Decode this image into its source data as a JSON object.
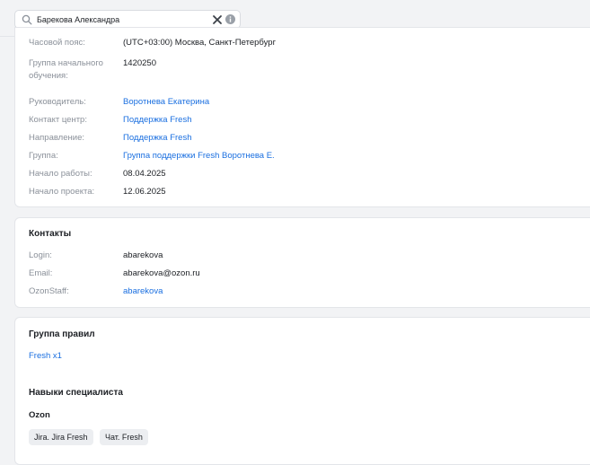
{
  "search": {
    "value": "Барекова Александра",
    "search_icon": "search-icon",
    "clear_icon": "close-icon",
    "info_icon": "info-icon"
  },
  "profile": {
    "rows": [
      {
        "label": "Часовой пояс:",
        "value": "(UTC+03:00) Москва, Санкт-Петербург"
      },
      {
        "label": "Группа начального обучения:",
        "value": "1420250"
      },
      {
        "label": "Руководитель:",
        "value": "Воротнева Екатерина"
      },
      {
        "label": "Контакт центр:",
        "value": "Поддержка Fresh"
      },
      {
        "label": "Направление:",
        "value": "Поддержка Fresh"
      },
      {
        "label": "Группа:",
        "value": "Группа поддержки Fresh Воротнева Е."
      },
      {
        "label": "Начало работы:",
        "value": "08.04.2025"
      },
      {
        "label": "Начало проекта:",
        "value": "12.06.2025"
      }
    ]
  },
  "contacts": {
    "title": "Контакты",
    "rows": [
      {
        "label": "Login:",
        "value": "abarekova"
      },
      {
        "label": "Email:",
        "value": "abarekova@ozon.ru"
      },
      {
        "label": "OzonStaff:",
        "value": "abarekova"
      }
    ]
  },
  "rules": {
    "title": "Группа правил",
    "link": "Fresh x1",
    "skills_title": "Навыки специалиста",
    "skills_group": "Ozon",
    "chips": [
      "Jira. Jira Fresh",
      "Чат. Fresh"
    ]
  },
  "colors": {
    "link": "#1a6fe0",
    "label": "#8a9099",
    "chip_bg": "#eceef1"
  }
}
